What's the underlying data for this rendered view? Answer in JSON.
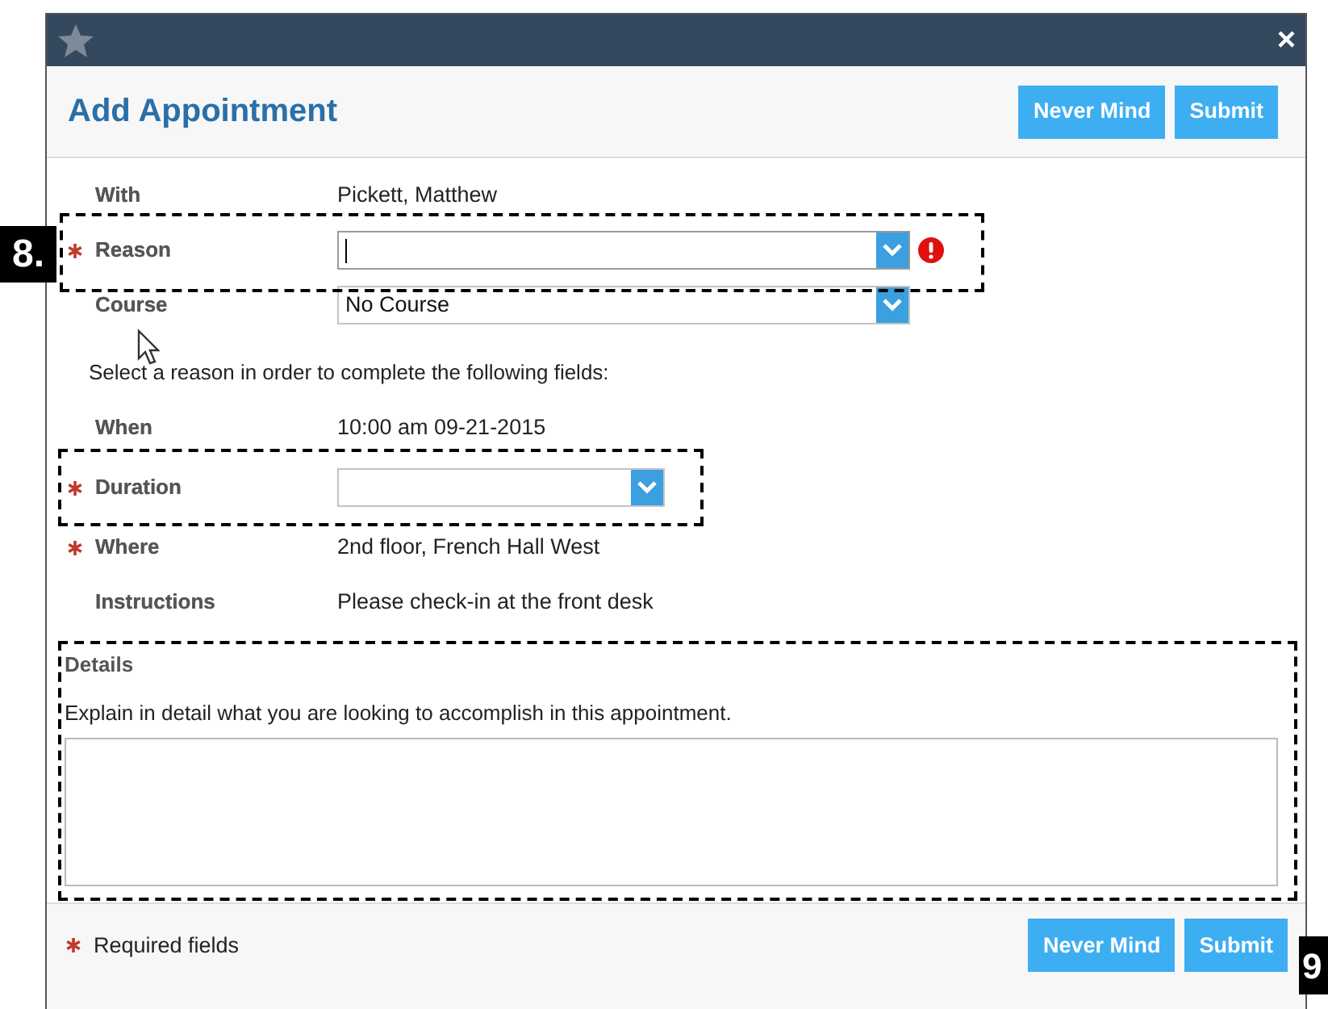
{
  "window": {
    "close": "×"
  },
  "header": {
    "title": "Add Appointment",
    "buttons": [
      "Never Mind",
      "Submit"
    ]
  },
  "fields": [
    {
      "kind": "text",
      "label": "With",
      "required": false,
      "value": "Pickett, Matthew"
    },
    {
      "kind": "select",
      "label": "Reason",
      "required": true,
      "error": true,
      "focused": true
    },
    {
      "kind": "select",
      "label": "Course",
      "required": false,
      "value": "No Course",
      "error": false,
      "focused": false
    },
    {
      "kind": "note",
      "text": "Select a reason in order to complete the following fields:"
    },
    {
      "kind": "text",
      "label": "When",
      "required": false,
      "value": "10:00 am 09-21-2015"
    },
    {
      "kind": "short_select",
      "label": "Duration",
      "required": true,
      "error": false,
      "focused": false
    },
    {
      "kind": "text",
      "label": "Where",
      "required": true,
      "value": "2nd floor, French Hall West"
    },
    {
      "kind": "text",
      "label": "Instructions",
      "required": false,
      "value": "Please check-in at the front desk"
    }
  ],
  "details": {
    "label": "Details",
    "prompt": "Explain in detail what you are looking to accomplish in this appointment."
  },
  "footer": {
    "required_note": "Required fields",
    "buttons": [
      "Never Mind",
      "Submit"
    ]
  },
  "annotations": [
    {
      "label": "8."
    },
    {
      "label": "9"
    }
  ]
}
